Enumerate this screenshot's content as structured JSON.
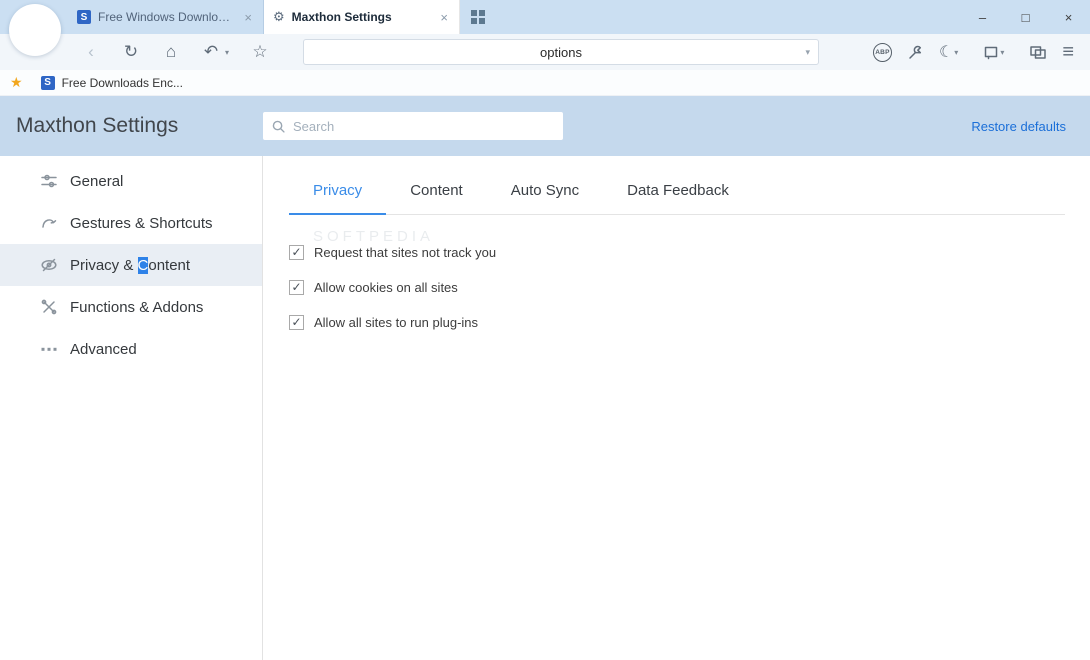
{
  "window_controls": {
    "minimize": "–",
    "maximize": "□",
    "close": "×"
  },
  "tabbar": {
    "tabs": [
      {
        "icon_letter": "S",
        "label": "Free Windows Downloads",
        "close": "×"
      },
      {
        "icon_gear": "⚙",
        "label": "Maxthon Settings",
        "close": "×"
      }
    ]
  },
  "toolbar": {
    "back": "‹",
    "reload": "↻",
    "home": "⌂",
    "undo": "↶",
    "caret": "▾",
    "favorite": "☆",
    "address_value": "options",
    "adblock": "ABP",
    "night": "☾",
    "menu": "≡"
  },
  "bookmarks": {
    "star": "★",
    "items": [
      {
        "icon_letter": "S",
        "label": "Free Downloads Enc..."
      }
    ]
  },
  "header": {
    "title": "Maxthon Settings",
    "search_placeholder": "Search",
    "restore": "Restore defaults"
  },
  "sidebar": {
    "items": [
      {
        "label": "General"
      },
      {
        "label": "Gestures & Shortcuts"
      },
      {
        "label": "Privacy & Content",
        "label_prefix": "Privacy & ",
        "label_highlight": "C",
        "label_suffix": "ontent",
        "selected": true
      },
      {
        "label": "Functions & Addons"
      },
      {
        "label": "Advanced"
      }
    ]
  },
  "content": {
    "tabs": [
      {
        "label": "Privacy",
        "active": true
      },
      {
        "label": "Content"
      },
      {
        "label": "Auto Sync"
      },
      {
        "label": "Data Feedback"
      }
    ],
    "watermark": "softpedia",
    "options": [
      {
        "check": "✓",
        "label": "Request that sites not track you",
        "checked": true
      },
      {
        "check": "✓",
        "label": "Allow cookies on all sites",
        "checked": true
      },
      {
        "check": "✓",
        "label": "Allow all sites to run plug-ins",
        "checked": true
      }
    ]
  },
  "colors": {
    "accent_blue": "#3a8ce8",
    "link_blue": "#1b6fd8",
    "selection_blue": "#2e82e8",
    "header_bg": "#c5d9ed",
    "tabbar_bg": "#cbdff2"
  }
}
